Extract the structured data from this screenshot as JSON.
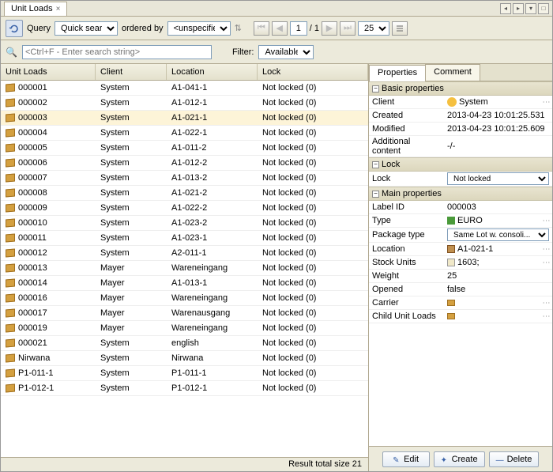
{
  "tab": {
    "title": "Unit Loads"
  },
  "toolbar": {
    "query_label": "Query",
    "query_value": "Quick search",
    "ordered_label": "ordered by",
    "ordered_value": "<unspecified>",
    "page_current": "1",
    "page_sep": "/",
    "page_total": "1",
    "page_size": "25"
  },
  "filter": {
    "placeholder": "<Ctrl+F - Enter search string>",
    "label": "Filter:",
    "value": "Available"
  },
  "grid": {
    "headers": {
      "c1": "Unit Loads",
      "c2": "Client",
      "c3": "Location",
      "c4": "Lock"
    },
    "rows": [
      {
        "id": "000001",
        "client": "System",
        "loc": "A1-041-1",
        "lock": "Not locked (0)"
      },
      {
        "id": "000002",
        "client": "System",
        "loc": "A1-012-1",
        "lock": "Not locked (0)"
      },
      {
        "id": "000003",
        "client": "System",
        "loc": "A1-021-1",
        "lock": "Not locked (0)"
      },
      {
        "id": "000004",
        "client": "System",
        "loc": "A1-022-1",
        "lock": "Not locked (0)"
      },
      {
        "id": "000005",
        "client": "System",
        "loc": "A1-011-2",
        "lock": "Not locked (0)"
      },
      {
        "id": "000006",
        "client": "System",
        "loc": "A1-012-2",
        "lock": "Not locked (0)"
      },
      {
        "id": "000007",
        "client": "System",
        "loc": "A1-013-2",
        "lock": "Not locked (0)"
      },
      {
        "id": "000008",
        "client": "System",
        "loc": "A1-021-2",
        "lock": "Not locked (0)"
      },
      {
        "id": "000009",
        "client": "System",
        "loc": "A1-022-2",
        "lock": "Not locked (0)"
      },
      {
        "id": "000010",
        "client": "System",
        "loc": "A1-023-2",
        "lock": "Not locked (0)"
      },
      {
        "id": "000011",
        "client": "System",
        "loc": "A1-023-1",
        "lock": "Not locked (0)"
      },
      {
        "id": "000012",
        "client": "System",
        "loc": "A2-011-1",
        "lock": "Not locked (0)"
      },
      {
        "id": "000013",
        "client": "Mayer",
        "loc": "Wareneingang",
        "lock": "Not locked (0)"
      },
      {
        "id": "000014",
        "client": "Mayer",
        "loc": "A1-013-1",
        "lock": "Not locked (0)"
      },
      {
        "id": "000016",
        "client": "Mayer",
        "loc": "Wareneingang",
        "lock": "Not locked (0)"
      },
      {
        "id": "000017",
        "client": "Mayer",
        "loc": "Warenausgang",
        "lock": "Not locked (0)"
      },
      {
        "id": "000019",
        "client": "Mayer",
        "loc": "Wareneingang",
        "lock": "Not locked (0)"
      },
      {
        "id": "000021",
        "client": "System",
        "loc": "english",
        "lock": "Not locked (0)"
      },
      {
        "id": "Nirwana",
        "client": "System",
        "loc": "Nirwana",
        "lock": "Not locked (0)"
      },
      {
        "id": "P1-011-1",
        "client": "System",
        "loc": "P1-011-1",
        "lock": "Not locked (0)"
      },
      {
        "id": "P1-012-1",
        "client": "System",
        "loc": "P1-012-1",
        "lock": "Not locked (0)"
      }
    ],
    "selected_index": 2,
    "status": "Result total size 21"
  },
  "props": {
    "tabs": {
      "properties": "Properties",
      "comment": "Comment"
    },
    "sections": {
      "basic": "Basic properties",
      "lock": "Lock",
      "main": "Main properties"
    },
    "basic": {
      "client_l": "Client",
      "client_v": "System",
      "created_l": "Created",
      "created_v": "2013-04-23 10:01:25.531",
      "modified_l": "Modified",
      "modified_v": "2013-04-23 10:01:25.609",
      "addl_l": "Additional content",
      "addl_v": "-/-"
    },
    "lock": {
      "lock_l": "Lock",
      "lock_v": "Not locked"
    },
    "main": {
      "label_l": "Label ID",
      "label_v": "000003",
      "type_l": "Type",
      "type_v": "EURO",
      "pkg_l": "Package type",
      "pkg_v": "Same Lot w. consoli...",
      "loc_l": "Location",
      "loc_v": "A1-021-1",
      "su_l": "Stock Units",
      "su_v": "1603;",
      "weight_l": "Weight",
      "weight_v": "25",
      "opened_l": "Opened",
      "opened_v": "false",
      "carrier_l": "Carrier",
      "carrier_v": "",
      "child_l": "Child Unit Loads",
      "child_v": ""
    }
  },
  "buttons": {
    "edit": "Edit",
    "create": "Create",
    "delete": "Delete"
  }
}
